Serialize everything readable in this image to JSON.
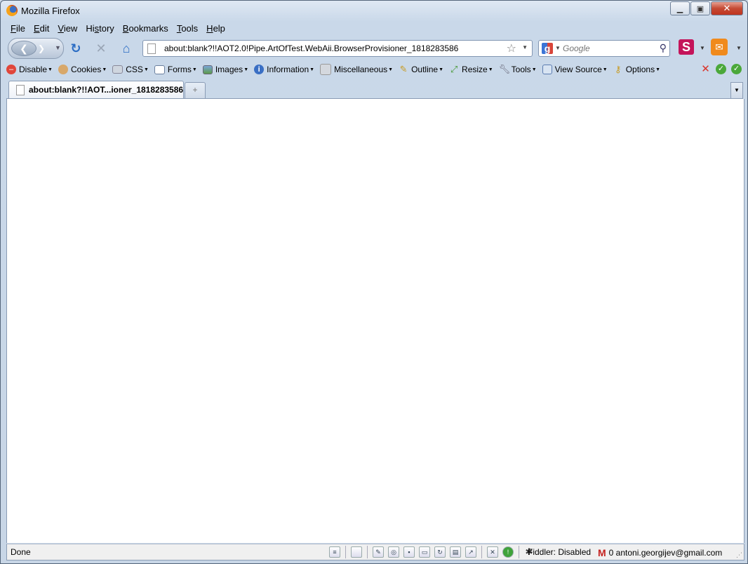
{
  "window": {
    "title": "Mozilla Firefox"
  },
  "caption": {
    "minimize": "▭",
    "maximize": "□",
    "close": "✕"
  },
  "menubar": {
    "items": [
      {
        "label": "File",
        "key": "F",
        "rest": "ile"
      },
      {
        "label": "Edit",
        "key": "E",
        "rest": "dit"
      },
      {
        "label": "View",
        "key": "V",
        "rest": "iew"
      },
      {
        "label": "History",
        "key": "",
        "pre": "Hi",
        "key2": "s",
        "rest": "tory"
      },
      {
        "label": "Bookmarks",
        "key": "B",
        "rest": "ookmarks"
      },
      {
        "label": "Tools",
        "key": "T",
        "rest": "ools"
      },
      {
        "label": "Help",
        "key": "H",
        "rest": "elp"
      }
    ]
  },
  "navbar": {
    "url": "about:blank?!!AOT2.0!Pipe.ArtOfTest.WebAii.BrowserProvisioner_1818283586",
    "search_placeholder": "Google"
  },
  "webdev": {
    "items": [
      {
        "label": "Disable",
        "icon": "disable-icon"
      },
      {
        "label": "Cookies",
        "icon": "cookies-icon"
      },
      {
        "label": "CSS",
        "icon": "css-icon"
      },
      {
        "label": "Forms",
        "icon": "forms-icon"
      },
      {
        "label": "Images",
        "icon": "images-icon"
      },
      {
        "label": "Information",
        "icon": "information-icon"
      },
      {
        "label": "Miscellaneous",
        "icon": "miscellaneous-icon"
      },
      {
        "label": "Outline",
        "icon": "outline-icon"
      },
      {
        "label": "Resize",
        "icon": "resize-icon"
      },
      {
        "label": "Tools",
        "icon": "tools-icon"
      },
      {
        "label": "View Source",
        "icon": "view-source-icon"
      },
      {
        "label": "Options",
        "icon": "options-icon"
      }
    ]
  },
  "tabs": [
    {
      "label": "about:blank?!!AOT...ioner_1818283586",
      "active": true
    }
  ],
  "statusbar": {
    "status": "Done",
    "fiddler": "Fiddler: Disabled",
    "gmail": "0 antoni.georgijev@gmail.com"
  },
  "colors": {
    "chrome_bg": "#c9d8e9",
    "close_red": "#c0341f",
    "gmail_red": "#c5221f",
    "s_ext": "#c4145a",
    "mail_ext": "#f08a1c"
  }
}
